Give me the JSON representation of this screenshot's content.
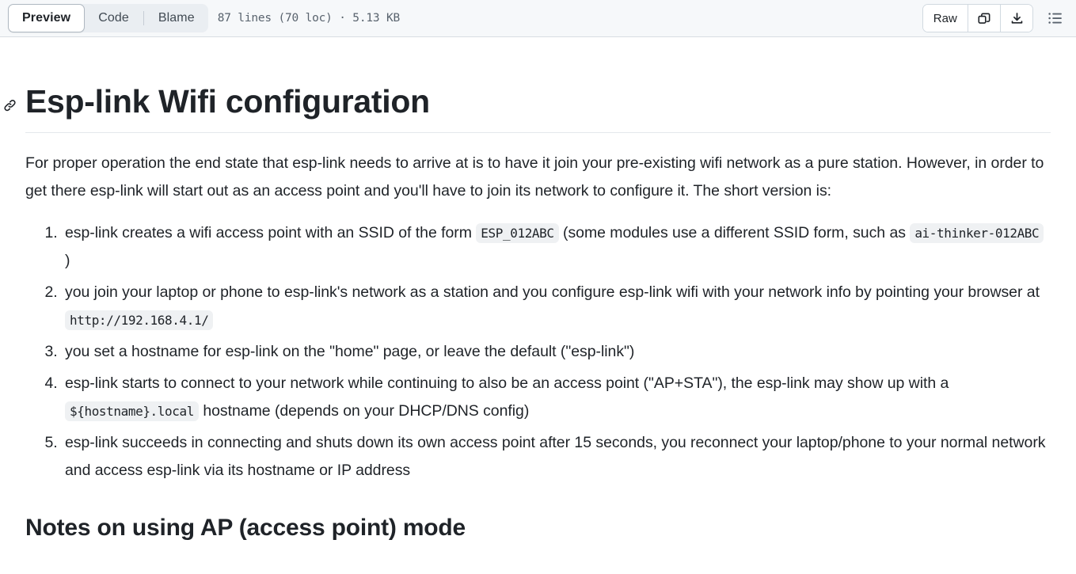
{
  "header": {
    "tabs": [
      {
        "label": "Preview",
        "selected": true
      },
      {
        "label": "Code",
        "selected": false
      },
      {
        "label": "Blame",
        "selected": false
      }
    ],
    "file_meta": "87 lines (70 loc) · 5.13 KB",
    "raw_label": "Raw",
    "copy_icon": "copy-icon",
    "download_icon": "download-icon",
    "outline_icon": "outline-list-icon"
  },
  "document": {
    "anchor_icon": "link-anchor-icon",
    "title": "Esp-link Wifi configuration",
    "intro_paragraph": "For proper operation the end state that esp-link needs to arrive at is to have it join your pre-existing wifi network as a pure station. However, in order to get there esp-link will start out as an access point and you'll have to join its network to configure it. The short version is:",
    "steps": [
      {
        "parts": [
          {
            "type": "text",
            "value": "esp-link creates a wifi access point with an SSID of the form "
          },
          {
            "type": "code",
            "value": "ESP_012ABC"
          },
          {
            "type": "text",
            "value": " (some modules use a different SSID form, such as "
          },
          {
            "type": "code",
            "value": "ai-thinker-012ABC"
          },
          {
            "type": "text",
            "value": " )"
          }
        ]
      },
      {
        "parts": [
          {
            "type": "text",
            "value": "you join your laptop or phone to esp-link's network as a station and you configure esp-link wifi with your network info by pointing your browser at "
          },
          {
            "type": "code",
            "value": "http://192.168.4.1/"
          }
        ]
      },
      {
        "parts": [
          {
            "type": "text",
            "value": "you set a hostname for esp-link on the \"home\" page, or leave the default (\"esp-link\")"
          }
        ]
      },
      {
        "parts": [
          {
            "type": "text",
            "value": "esp-link starts to connect to your network while continuing to also be an access point (\"AP+STA\"), the esp-link may show up with a "
          },
          {
            "type": "code",
            "value": "${hostname}.local"
          },
          {
            "type": "text",
            "value": " hostname (depends on your DHCP/DNS config)"
          }
        ]
      },
      {
        "parts": [
          {
            "type": "text",
            "value": "esp-link succeeds in connecting and shuts down its own access point after 15 seconds, you reconnect your laptop/phone to your normal network and access esp-link via its hostname or IP address"
          }
        ]
      }
    ],
    "section_heading": "Notes on using AP (access point) mode"
  },
  "colors": {
    "header_bg": "#f6f8fa",
    "header_border": "#d9dee3",
    "segmented_track": "#eaeef2",
    "code_bg": "#eff1f3",
    "text": "#1f2328",
    "muted_text": "#59636e"
  }
}
